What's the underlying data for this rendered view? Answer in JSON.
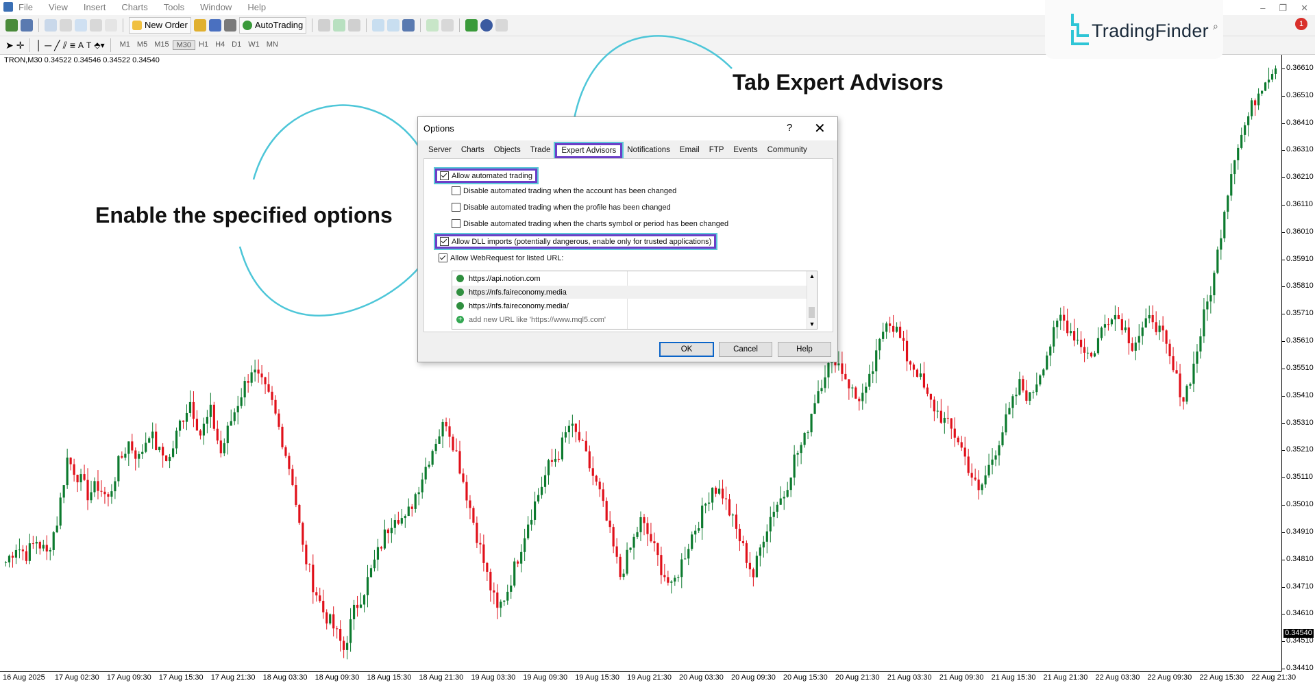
{
  "menubar": {
    "items": [
      "File",
      "View",
      "Insert",
      "Charts",
      "Tools",
      "Window",
      "Help"
    ]
  },
  "toolbar": {
    "new_order_label": "New Order",
    "autotrading_label": "AutoTrading",
    "timeframes": [
      "M1",
      "M5",
      "M15",
      "M30",
      "H1",
      "H4",
      "D1",
      "W1",
      "MN"
    ],
    "active_timeframe": "M30"
  },
  "brand": {
    "name": "TradingFinder",
    "accent": "#2ec5d6"
  },
  "chart": {
    "symbol_info": "TRON,M30  0.34522 0.34546 0.34522 0.34540",
    "current_price": "0.34540",
    "bull_color": "#0c7a2e",
    "bear_color": "#e0101a"
  },
  "chart_data": {
    "type": "candlestick",
    "symbol": "TRON",
    "timeframe": "M30",
    "y_ticks": [
      "0.36610",
      "0.36510",
      "0.36410",
      "0.36310",
      "0.36210",
      "0.36110",
      "0.36010",
      "0.35910",
      "0.35810",
      "0.35710",
      "0.35610",
      "0.35510",
      "0.35410",
      "0.35310",
      "0.35210",
      "0.35110",
      "0.35010",
      "0.34910",
      "0.34810",
      "0.34710",
      "0.34610",
      "0.34510",
      "0.34410"
    ],
    "x_ticks": [
      "16 Aug 2025",
      "17 Aug 02:30",
      "17 Aug 09:30",
      "17 Aug 15:30",
      "17 Aug 21:30",
      "18 Aug 03:30",
      "18 Aug 09:30",
      "18 Aug 15:30",
      "18 Aug 21:30",
      "19 Aug 03:30",
      "19 Aug 09:30",
      "19 Aug 15:30",
      "19 Aug 21:30",
      "20 Aug 03:30",
      "20 Aug 09:30",
      "20 Aug 15:30",
      "20 Aug 21:30",
      "21 Aug 03:30",
      "21 Aug 09:30",
      "21 Aug 15:30",
      "21 Aug 21:30",
      "22 Aug 03:30",
      "22 Aug 09:30",
      "22 Aug 15:30",
      "22 Aug 21:30"
    ],
    "ylim": [
      0.344,
      0.3666
    ],
    "close_path": [
      [
        0.348,
        0.3486,
        0.3483,
        0.3488,
        0.3483,
        0.3495,
        0.3518,
        0.3512,
        0.3505,
        0.3508,
        0.3503,
        0.3516,
        0.3524,
        0.3518,
        0.3528,
        0.352,
        0.3518,
        0.3531,
        0.3539,
        0.3527,
        0.3535,
        0.352,
        0.3532,
        0.3542,
        0.3551
      ],
      [
        0.3545,
        0.3538,
        0.3525,
        0.351,
        0.3485,
        0.3472,
        0.3462,
        0.3456,
        0.3448,
        0.3462,
        0.347,
        0.348,
        0.349,
        0.3498,
        0.3495,
        0.3505,
        0.3515,
        0.3525,
        0.3532,
        0.352,
        0.3505,
        0.349,
        0.3475,
        0.3462,
        0.347
      ],
      [
        0.3482,
        0.3495,
        0.3505,
        0.3515,
        0.352,
        0.353,
        0.3525,
        0.3515,
        0.3505,
        0.349,
        0.3475,
        0.3485,
        0.3495,
        0.3488,
        0.3478,
        0.347,
        0.348,
        0.349,
        0.3498,
        0.3508,
        0.3505,
        0.3495,
        0.3485,
        0.3475,
        0.349
      ],
      [
        0.35,
        0.3505,
        0.3518,
        0.3525,
        0.354,
        0.355,
        0.3555,
        0.3548,
        0.354,
        0.3542,
        0.3555,
        0.357,
        0.3565,
        0.3555,
        0.355,
        0.354,
        0.3535,
        0.353,
        0.3525,
        0.3515,
        0.3505,
        0.3515,
        0.3525,
        0.3535,
        0.3545
      ],
      [
        0.354,
        0.355,
        0.356,
        0.357,
        0.3565,
        0.356,
        0.3555,
        0.3565,
        0.3572,
        0.3568,
        0.356,
        0.3565,
        0.357,
        0.3562,
        0.355,
        0.354,
        0.3552,
        0.357,
        0.3585,
        0.361,
        0.363,
        0.364,
        0.365,
        0.3658,
        0.3661
      ]
    ]
  },
  "annotations": {
    "tab_label": "Tab Expert Advisors",
    "options_label": "Enable the specified options"
  },
  "dialog": {
    "title": "Options",
    "help_glyph": "?",
    "close_glyph": "✕",
    "tabs": [
      "Server",
      "Charts",
      "Objects",
      "Trade",
      "Expert Advisors",
      "Notifications",
      "Email",
      "FTP",
      "Events",
      "Community"
    ],
    "active_tab": "Expert Advisors",
    "options": {
      "allow_automated": {
        "label": "Allow automated trading",
        "checked": true
      },
      "disable_account": {
        "label": "Disable automated trading when the account has been changed",
        "checked": false
      },
      "disable_profile": {
        "label": "Disable automated trading when the profile has been changed",
        "checked": false
      },
      "disable_symbol": {
        "label": "Disable automated trading when the charts symbol or period has been changed",
        "checked": false
      },
      "allow_dll": {
        "label": "Allow DLL imports (potentially dangerous, enable only for trusted applications)",
        "checked": true
      },
      "allow_webrequest": {
        "label": "Allow WebRequest for listed URL:",
        "checked": true
      }
    },
    "urls": [
      "https://api.notion.com",
      "https://nfs.faireconomy.media",
      "https://nfs.faireconomy.media/"
    ],
    "add_url_placeholder": "add new URL like 'https://www.mql5.com'",
    "buttons": {
      "ok": "OK",
      "cancel": "Cancel",
      "help": "Help"
    }
  }
}
